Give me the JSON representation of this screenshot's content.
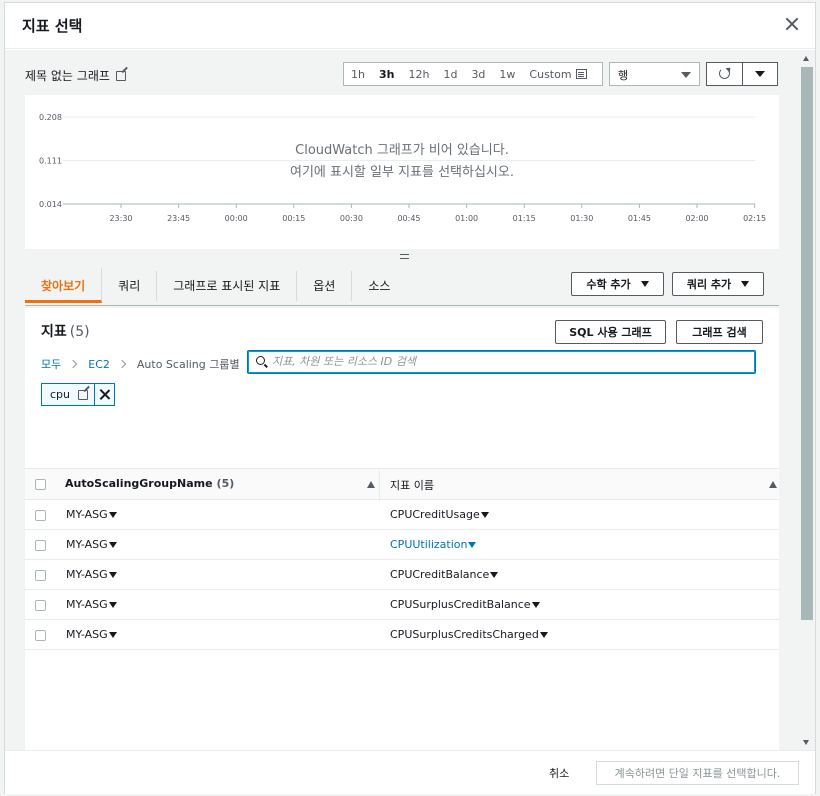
{
  "modal": {
    "title": "지표 선택"
  },
  "graph": {
    "title": "제목 없는 그래프",
    "time_ranges": [
      "1h",
      "3h",
      "12h",
      "1d",
      "3d",
      "1w",
      "Custom"
    ],
    "active_range": "3h",
    "view_select": "행",
    "empty_line1": "CloudWatch 그래프가 비어 있습니다.",
    "empty_line2": "여기에 표시할 일부 지표를 선택하십시오."
  },
  "chart_data": {
    "type": "line",
    "yticks": [
      "0.208",
      "0.111",
      "0.014"
    ],
    "xticks": [
      "23:30",
      "23:45",
      "00:00",
      "00:15",
      "00:30",
      "00:45",
      "01:00",
      "01:15",
      "01:30",
      "01:45",
      "02:00",
      "02:15"
    ],
    "series": []
  },
  "tabs": [
    "찾아보기",
    "쿼리",
    "그래프로 표시된 지표",
    "옵션",
    "소스"
  ],
  "actions": {
    "math": "수학 추가",
    "query": "쿼리 추가",
    "sql": "SQL 사용 그래프",
    "graph_search": "그래프 검색"
  },
  "metrics": {
    "title": "지표",
    "count": "(5)",
    "breadcrumb": {
      "all": "모두",
      "ec2": "EC2",
      "current": "Auto Scaling 그룹별"
    },
    "search_placeholder": "지표, 차원 또는 리소스 ID 검색",
    "token": "cpu",
    "columns": {
      "group": "AutoScalingGroupName",
      "group_count": "(5)",
      "metric": "지표 이름"
    },
    "rows": [
      {
        "group": "MY-ASG",
        "metric": "CPUCreditUsage"
      },
      {
        "group": "MY-ASG",
        "metric": "CPUUtilization"
      },
      {
        "group": "MY-ASG",
        "metric": "CPUCreditBalance"
      },
      {
        "group": "MY-ASG",
        "metric": "CPUSurplusCreditBalance"
      },
      {
        "group": "MY-ASG",
        "metric": "CPUSurplusCreditsCharged"
      }
    ]
  },
  "footer": {
    "cancel": "취소",
    "continue": "계속하려면 단일 지표를 선택합니다."
  },
  "colors": {
    "accent": "#ec7211",
    "link": "#0073bb"
  }
}
